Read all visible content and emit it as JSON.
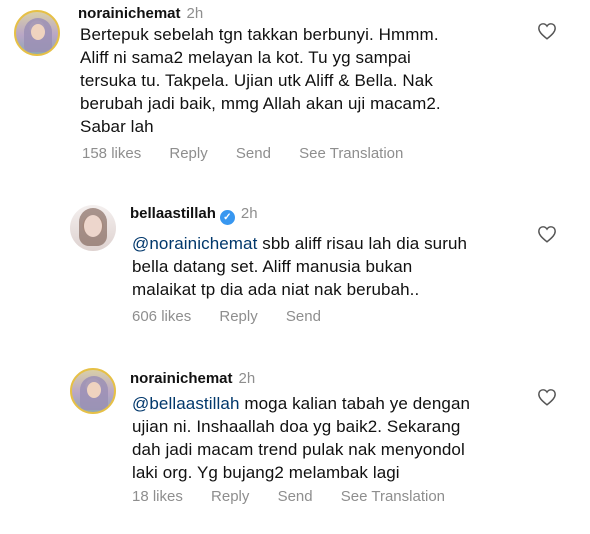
{
  "comments": [
    {
      "username": "norainichemat",
      "time": "2h",
      "verified": false,
      "mention": "",
      "lines": [
        "Bertepuk sebelah tgn takkan berbunyi. Hmmm.",
        "Aliff ni sama2 melayan la kot. Tu yg sampai",
        "tersuka tu. Takpela. Ujian utk Aliff & Bella. Nak",
        "berubah jadi baik, mmg Allah akan uji macam2.",
        "Sabar lah"
      ],
      "likes": "158 likes",
      "reply": "Reply",
      "send": "Send",
      "translate": "See Translation"
    },
    {
      "username": "bellaastillah",
      "time": "2h",
      "verified": true,
      "mention": "@norainichemat",
      "lines": [
        " sbb aliff risau lah dia suruh",
        "bella datang set. Aliff manusia bukan",
        "malaikat tp dia ada niat nak berubah.."
      ],
      "likes": "606 likes",
      "reply": "Reply",
      "send": "Send"
    },
    {
      "username": "norainichemat",
      "time": "2h",
      "verified": false,
      "mention": "@bellaastillah",
      "lines": [
        " moga kalian tabah ye dengan",
        "ujian ni. Inshaallah doa yg baik2. Sekarang",
        "dah jadi macam trend pulak nak menyondol",
        "laki org. Yg bujang2 melambak lagi"
      ],
      "likes": "18 likes",
      "reply": "Reply",
      "send": "Send",
      "translate": "See Translation"
    }
  ],
  "icons": {
    "like": "heart-icon",
    "verified": "verified-badge-icon"
  },
  "colors": {
    "mention": "#00376b",
    "verified": "#3897f0",
    "muted": "#8e8e8e",
    "story_ring": "#e6c046"
  }
}
